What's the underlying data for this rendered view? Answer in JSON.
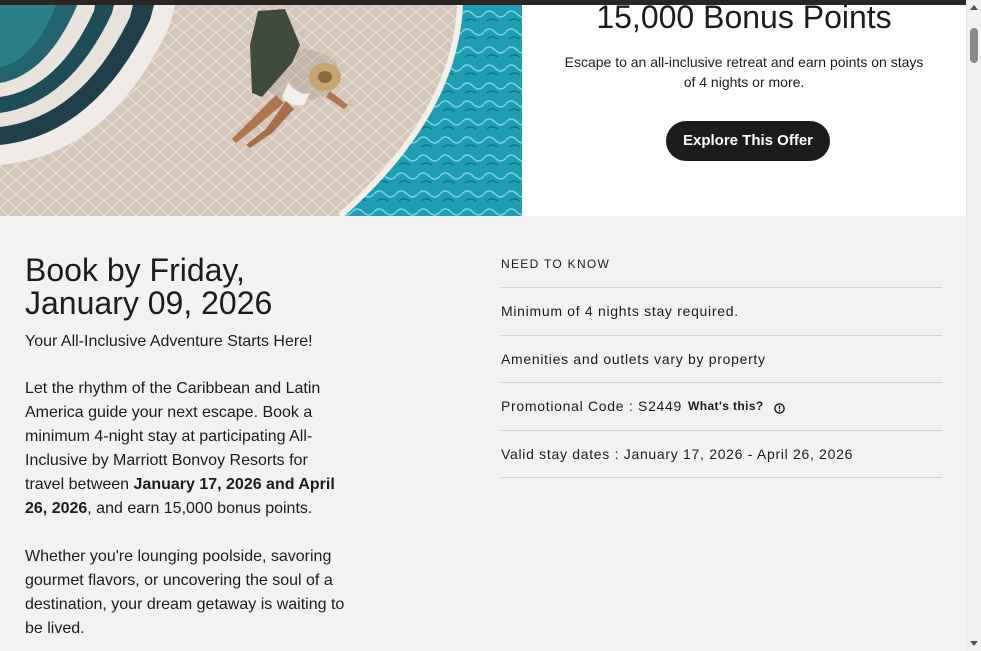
{
  "hero": {
    "image_alt": "Aerial view of a woman in a sun hat sitting on a tiled pool deck beside turquoise water",
    "offer_title": "15,000 Bonus Points",
    "offer_description": "Escape to an all-inclusive retreat and earn points on stays of 4 nights or more.",
    "cta_label": "Explore This Offer"
  },
  "main": {
    "book_title": "Book by Friday, January 09, 2026",
    "subtitle": "Your All-Inclusive Adventure Starts Here!",
    "para1": {
      "part1": "Let the rhythm of the Caribbean and Latin America guide your next escape. Book a minimum 4-night stay at participating All-Inclusive by Marriott Bonvoy Resorts for travel between ",
      "bold": "January 17, 2026 and April 26, 2026",
      "part2": ", and earn 15,000 bonus points."
    },
    "para2": "Whether you're lounging poolside, savoring gourmet flavors, or uncovering the soul of a destination, your dream getaway is waiting to be lived."
  },
  "need_to_know": {
    "heading": "NEED TO KNOW",
    "items": [
      {
        "text": "Minimum of 4 nights stay required."
      },
      {
        "text": "Amenities and outlets vary by property"
      },
      {
        "text": "Promotional Code : S2449",
        "link": "What's this?"
      },
      {
        "text": "Valid stay dates : January 17, 2026 - April 26, 2026"
      }
    ]
  },
  "colors": {
    "accent_button": "#1c1c1c",
    "page_background": "#f2f2f2",
    "pool_water": "#1f9bb0"
  },
  "icons": {
    "info": "info-circle-icon",
    "scroll_up": "scroll-up-arrow-icon",
    "scroll_down": "scroll-down-arrow-icon"
  }
}
